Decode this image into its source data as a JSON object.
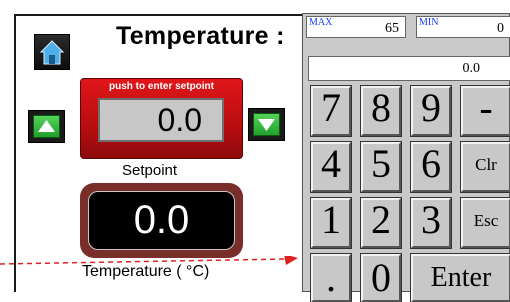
{
  "screen": {
    "title": "Temperature",
    "title_partial": "Temperature :",
    "push_label": "push to enter setpoint",
    "setpoint_value": "0.0",
    "setpoint_label": "Setpoint",
    "temperature_value": "0.0",
    "temperature_label": "Temperature ( °C)",
    "icons": [
      "home-icon",
      "up-arrow-icon",
      "down-arrow-icon"
    ]
  },
  "keypad": {
    "max_label": "MAX",
    "max_value": "65",
    "min_label": "MIN",
    "min_value": "0",
    "display_value": "0.0",
    "keys": {
      "k7": "7",
      "k8": "8",
      "k9": "9",
      "minus": "-",
      "k4": "4",
      "k5": "5",
      "k6": "6",
      "clr": "Clr",
      "k1": "1",
      "k2": "2",
      "k3": "3",
      "esc": "Esc",
      "dot": ".",
      "k0": "0",
      "enter": "Enter"
    }
  },
  "colors": {
    "setpoint_red": "#d01015",
    "arrow_green": "#2fb836",
    "temp_frame": "#7a2e2a",
    "pointer_red": "#e02020",
    "keypad_gray": "#c9c9c9",
    "limit_label_blue": "#1a3cff"
  }
}
